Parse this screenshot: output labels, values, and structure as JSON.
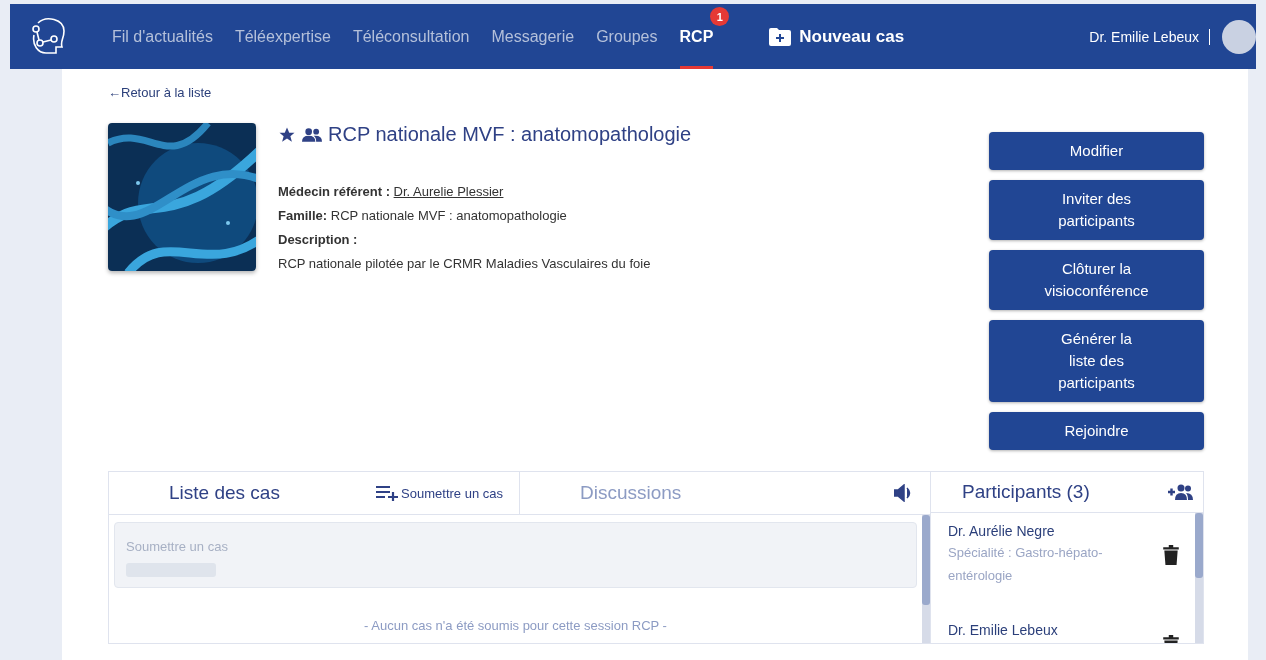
{
  "nav": {
    "items": [
      {
        "label": "Fil d'actualités",
        "selected": false
      },
      {
        "label": "Téléexpertise",
        "selected": false
      },
      {
        "label": "Téléconsultation",
        "selected": false
      },
      {
        "label": "Messagerie",
        "selected": false
      },
      {
        "label": "Groupes",
        "selected": false
      },
      {
        "label": "RCP",
        "selected": true,
        "badge": "1"
      }
    ],
    "new_case": "Nouveau cas",
    "user": "Dr. Emilie Lebeux"
  },
  "back_link": "←Retour à la liste",
  "rcp": {
    "title": "RCP nationale MVF : anatomopathologie",
    "favorite": true,
    "fields": [
      {
        "label": "Médecin référent :",
        "value": "Dr. Aurelie Plessier",
        "kind": "link"
      },
      {
        "label": "Famille:",
        "value": "RCP nationale MVF : anatomopathologie",
        "kind": "text"
      },
      {
        "label": "Description :"
      }
    ],
    "description": "RCP nationale pilotée par le CRMR Maladies Vasculaires du foie"
  },
  "actions": [
    {
      "lines": [
        "Modifier"
      ]
    },
    {
      "lines": [
        "Inviter des",
        "participants"
      ]
    },
    {
      "lines": [
        "Clôturer la",
        "visioconférence"
      ]
    },
    {
      "lines": [
        "Générer la",
        "liste des",
        "participants"
      ]
    },
    {
      "lines": [
        "Rejoindre"
      ]
    }
  ],
  "tabs": [
    {
      "label": "Liste des cas",
      "selected": true,
      "action": "Soumettre un cas"
    },
    {
      "label": "Discussions",
      "selected": false
    }
  ],
  "cases": {
    "submit_placeholder": "Soumettre un cas",
    "empty": "- Aucun cas n'a été soumis pour cette session RCP -"
  },
  "participants": {
    "title": "Participants (3)",
    "items": [
      {
        "name": "Dr. Aurélie Negre",
        "specialty": "Spécialité : Gastro-hépato-entérologie"
      },
      {
        "name": "Dr. Emilie Lebeux"
      }
    ]
  }
}
